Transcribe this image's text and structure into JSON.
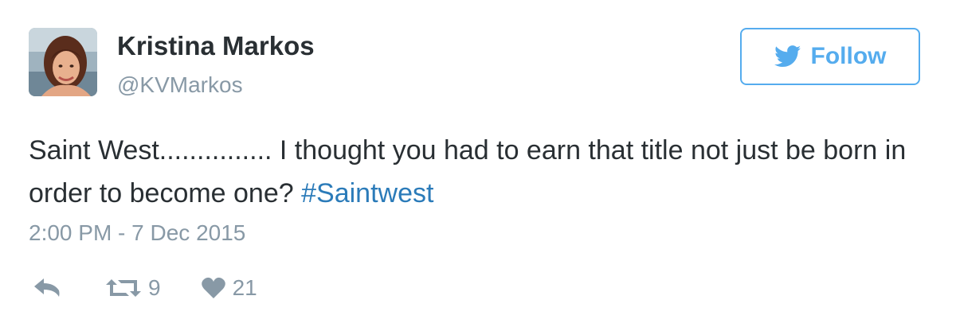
{
  "user": {
    "display_name": "Kristina Markos",
    "handle": "@KVMarkos",
    "avatar_icon": "profile-photo"
  },
  "follow_button": {
    "label": "Follow",
    "icon": "twitter-bird-icon",
    "color": "#55acee"
  },
  "tweet": {
    "text_before": "Saint West............... I thought you had to earn that title not just be born in order to become one? ",
    "hashtag": "#Saintwest",
    "timestamp": "2:00 PM - 7 Dec 2015"
  },
  "actions": {
    "reply": {
      "icon": "reply-icon"
    },
    "retweet": {
      "icon": "retweet-icon",
      "count": "9"
    },
    "like": {
      "icon": "heart-icon",
      "count": "21"
    }
  },
  "colors": {
    "text": "#292f33",
    "muted": "#8899a6",
    "link": "#2b7bb9",
    "accent": "#55acee"
  }
}
